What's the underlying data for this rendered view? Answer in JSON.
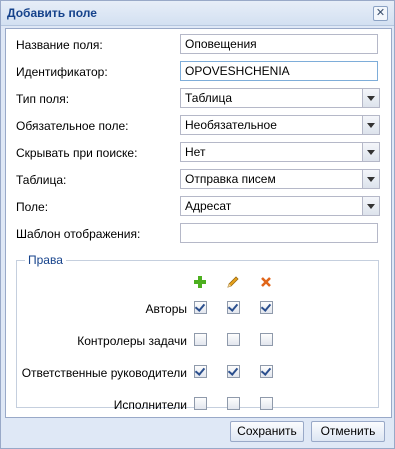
{
  "dialog": {
    "title": "Добавить поле",
    "close_icon": "close-icon"
  },
  "fields": {
    "name": {
      "label": "Название поля:",
      "value": "Оповещения"
    },
    "identifier": {
      "label": "Идентификатор:",
      "value": "OPOVESHCHENIA"
    },
    "type": {
      "label": "Тип поля:",
      "value": "Таблица"
    },
    "required": {
      "label": "Обязательное поле:",
      "value": "Необязательное"
    },
    "hide_in_search": {
      "label": "Скрывать при поиске:",
      "value": "Нет"
    },
    "table": {
      "label": "Таблица:",
      "value": "Отправка писем"
    },
    "field": {
      "label": "Поле:",
      "value": "Адресат"
    },
    "display_template": {
      "label": "Шаблон отображения:",
      "value": ""
    }
  },
  "rights": {
    "legend": "Права",
    "column_icons": [
      "add-icon",
      "edit-icon",
      "delete-icon"
    ],
    "colors": {
      "add": "#4caf1f",
      "edit": "#e8a21c",
      "delete": "#e0651a"
    },
    "rows": [
      {
        "label": "Авторы",
        "checks": [
          true,
          true,
          true
        ]
      },
      {
        "label": "Контролеры задачи",
        "checks": [
          false,
          false,
          false
        ]
      },
      {
        "label": "Ответственные руководители",
        "checks": [
          true,
          true,
          true
        ]
      },
      {
        "label": "Исполнители",
        "checks": [
          false,
          false,
          false
        ]
      }
    ]
  },
  "buttons": {
    "save": "Сохранить",
    "cancel": "Отменить"
  }
}
